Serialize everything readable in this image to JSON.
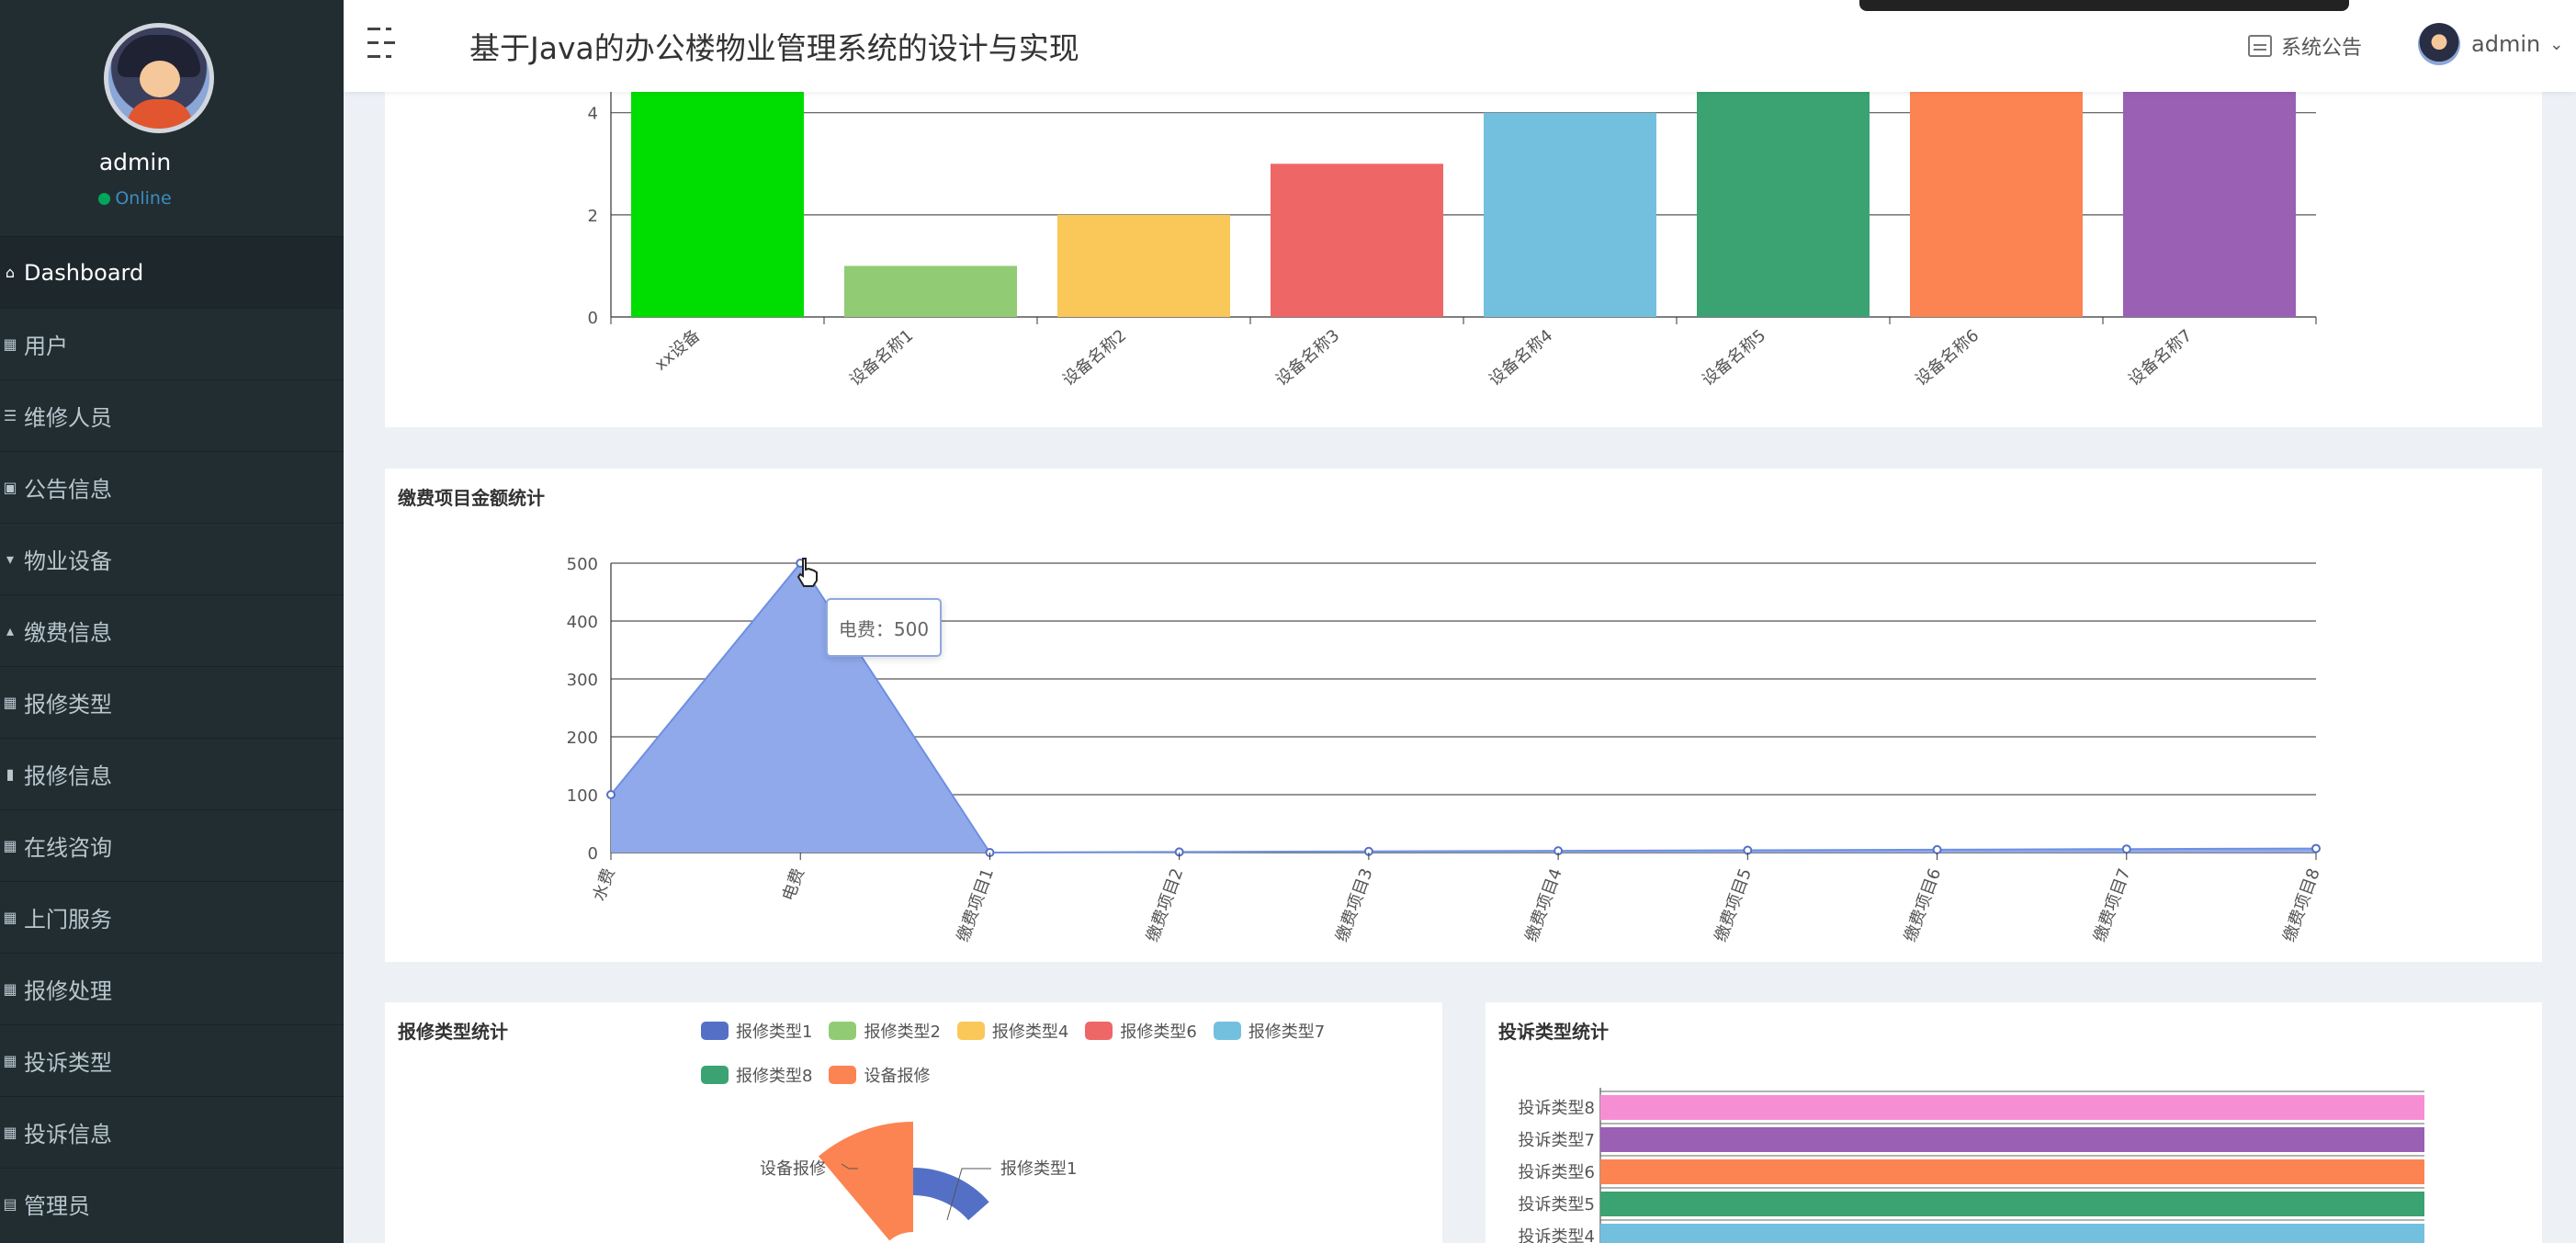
{
  "sidebar": {
    "username": "admin",
    "status": "Online",
    "items": [
      {
        "label": "Dashboard",
        "icon": "home-icon",
        "active": true
      },
      {
        "label": "用户",
        "icon": "grid-icon"
      },
      {
        "label": "维修人员",
        "icon": "sliders-icon"
      },
      {
        "label": "公告信息",
        "icon": "clipboard-icon"
      },
      {
        "label": "物业设备",
        "icon": "plug-icon"
      },
      {
        "label": "缴费信息",
        "icon": "thumbs-up-icon"
      },
      {
        "label": "报修类型",
        "icon": "grid-icon"
      },
      {
        "label": "报修信息",
        "icon": "bar-chart-icon"
      },
      {
        "label": "在线咨询",
        "icon": "grid-icon"
      },
      {
        "label": "上门服务",
        "icon": "grid-icon"
      },
      {
        "label": "报修处理",
        "icon": "grid-icon"
      },
      {
        "label": "投诉类型",
        "icon": "grid-icon"
      },
      {
        "label": "投诉信息",
        "icon": "grid-icon"
      },
      {
        "label": "管理员",
        "icon": "document-icon"
      }
    ]
  },
  "header": {
    "title": "基于Java的办公楼物业管理系统的设计与实现",
    "notice_label": "系统公告",
    "user_label": "admin"
  },
  "tooltip": {
    "text": "电费：500"
  },
  "colors": {
    "sidebar_bg": "#222d32",
    "area_fill": "#8fa9eb",
    "accent_online": "#00a65a"
  },
  "chart_data": [
    {
      "type": "bar",
      "categories": [
        "xx设备",
        "设备名称1",
        "设备名称2",
        "设备名称3",
        "设备名称4",
        "设备名称5",
        "设备名称6",
        "设备名称7"
      ],
      "values": [
        6,
        1,
        2,
        3,
        4,
        5,
        6,
        7
      ],
      "colors": [
        "#00dd00",
        "#91cc75",
        "#fac858",
        "#ee6666",
        "#73c0de",
        "#3ba272",
        "#fc8452",
        "#9a60b4"
      ],
      "yticks": [
        0,
        2,
        4
      ],
      "ylim": [
        0,
        5.2
      ],
      "grid": true,
      "title": ""
    },
    {
      "type": "area",
      "title": "缴费项目金额统计",
      "categories": [
        "水费",
        "电费",
        "缴费项目1",
        "缴费项目2",
        "缴费项目3",
        "缴费项目4",
        "缴费项目5",
        "缴费项目6",
        "缴费项目7",
        "缴费项目8"
      ],
      "values": [
        100,
        500,
        0,
        1,
        2,
        3,
        4,
        5,
        6,
        7
      ],
      "yticks": [
        0,
        100,
        200,
        300,
        400,
        500
      ],
      "ylim": [
        0,
        500
      ],
      "grid": true
    },
    {
      "type": "pie",
      "title": "报修类型统计",
      "legend": [
        {
          "name": "报修类型1",
          "color": "#5470c6"
        },
        {
          "name": "报修类型2",
          "color": "#91cc75"
        },
        {
          "name": "报修类型4",
          "color": "#fac858"
        },
        {
          "name": "报修类型6",
          "color": "#ee6666"
        },
        {
          "name": "报修类型7",
          "color": "#73c0de"
        },
        {
          "name": "报修类型8",
          "color": "#3ba272"
        },
        {
          "name": "设备报修",
          "color": "#fc8452"
        }
      ],
      "visible_labels": [
        "设备报修",
        "报修类型1"
      ],
      "legend_placement": "top"
    },
    {
      "type": "bar",
      "orientation": "horizontal",
      "title": "投诉类型统计",
      "categories": [
        "投诉类型8",
        "投诉类型7",
        "投诉类型6",
        "投诉类型5",
        "投诉类型4"
      ],
      "colors": [
        "#f78ed3",
        "#9a60b4",
        "#fc8452",
        "#3ba272",
        "#73c0de"
      ],
      "values": [
        1,
        1,
        1,
        1,
        1
      ]
    }
  ]
}
